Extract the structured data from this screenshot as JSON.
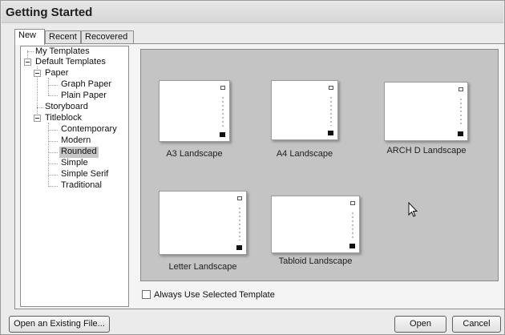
{
  "window": {
    "title": "Getting Started"
  },
  "tabs": [
    {
      "label": "New",
      "active": true
    },
    {
      "label": "Recent",
      "active": false
    },
    {
      "label": "Recovered",
      "active": false
    }
  ],
  "tree": {
    "my_templates": "My Templates",
    "default_templates": "Default Templates",
    "paper": "Paper",
    "graph_paper": "Graph Paper",
    "plain_paper": "Plain Paper",
    "storyboard": "Storyboard",
    "titleblock": "Titleblock",
    "contemporary": "Contemporary",
    "modern": "Modern",
    "rounded": "Rounded",
    "simple": "Simple",
    "simple_serif": "Simple Serif",
    "traditional": "Traditional",
    "selected": "Rounded"
  },
  "templates": [
    {
      "label": "A3 Landscape",
      "icon": "template-thumbnail"
    },
    {
      "label": "A4 Landscape",
      "icon": "template-thumbnail"
    },
    {
      "label": "ARCH D Landscape",
      "icon": "template-thumbnail"
    },
    {
      "label": "Letter Landscape",
      "icon": "template-thumbnail"
    },
    {
      "label": "Tabloid Landscape",
      "icon": "template-thumbnail"
    }
  ],
  "options": {
    "always_use_label": "Always Use Selected Template",
    "always_use_checked": false
  },
  "buttons": {
    "open_existing": "Open an Existing File...",
    "open": "Open",
    "cancel": "Cancel"
  },
  "icons": {
    "expander": "minus-expander-icon",
    "cursor": "mouse-pointer-icon"
  }
}
